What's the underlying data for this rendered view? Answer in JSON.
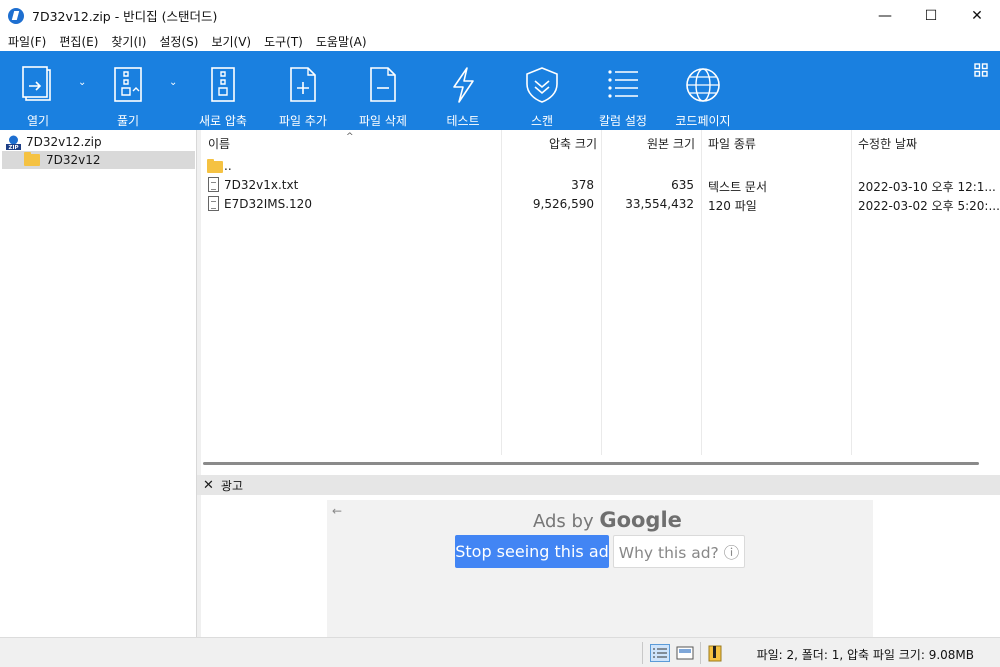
{
  "window": {
    "title": "7D32v12.zip - 반디집 (스탠더드)",
    "controls": {
      "minimize": "—",
      "maximize": "☐",
      "close": "✕"
    }
  },
  "menu": {
    "items": [
      "파일(F)",
      "편집(E)",
      "찾기(I)",
      "설정(S)",
      "보기(V)",
      "도구(T)",
      "도움말(A)"
    ]
  },
  "toolbar": {
    "buttons": [
      {
        "label": "열기",
        "icon": "open-archive-icon"
      },
      {
        "label": "풀기",
        "icon": "extract-icon"
      },
      {
        "label": "새로 압축",
        "icon": "new-archive-icon"
      },
      {
        "label": "파일 추가",
        "icon": "add-file-icon"
      },
      {
        "label": "파일 삭제",
        "icon": "delete-file-icon"
      },
      {
        "label": "테스트",
        "icon": "test-icon"
      },
      {
        "label": "스캔",
        "icon": "scan-shield-icon"
      },
      {
        "label": "칼럼 설정",
        "icon": "column-settings-icon"
      },
      {
        "label": "코드페이지",
        "icon": "codepage-globe-icon"
      }
    ],
    "accent": "#1a80e0"
  },
  "tree": {
    "root": "7D32v12.zip",
    "child": "7D32v12"
  },
  "filelist": {
    "columns": [
      "이름",
      "압축 크기",
      "원본 크기",
      "파일 종류",
      "수정한 날짜"
    ],
    "parent": "..",
    "rows": [
      {
        "name": "7D32v1x.txt",
        "packed": "378",
        "size": "635",
        "type": "텍스트 문서",
        "modified": "2022-03-10 오후 12:1..."
      },
      {
        "name": "E7D32IMS.120",
        "packed": "9,526,590",
        "size": "33,554,432",
        "type": "120 파일",
        "modified": "2022-03-02 오후 5:20:..."
      }
    ]
  },
  "ad": {
    "header_close": "✕",
    "header_label": "광고",
    "back": "←",
    "ads_by": "Ads by",
    "google": "Google",
    "stop_label": "Stop seeing this ad",
    "why_label": "Why this ad? ⓘ"
  },
  "status": {
    "text": "파일: 2, 폴더: 1, 압축 파일 크기: 9.08MB"
  }
}
